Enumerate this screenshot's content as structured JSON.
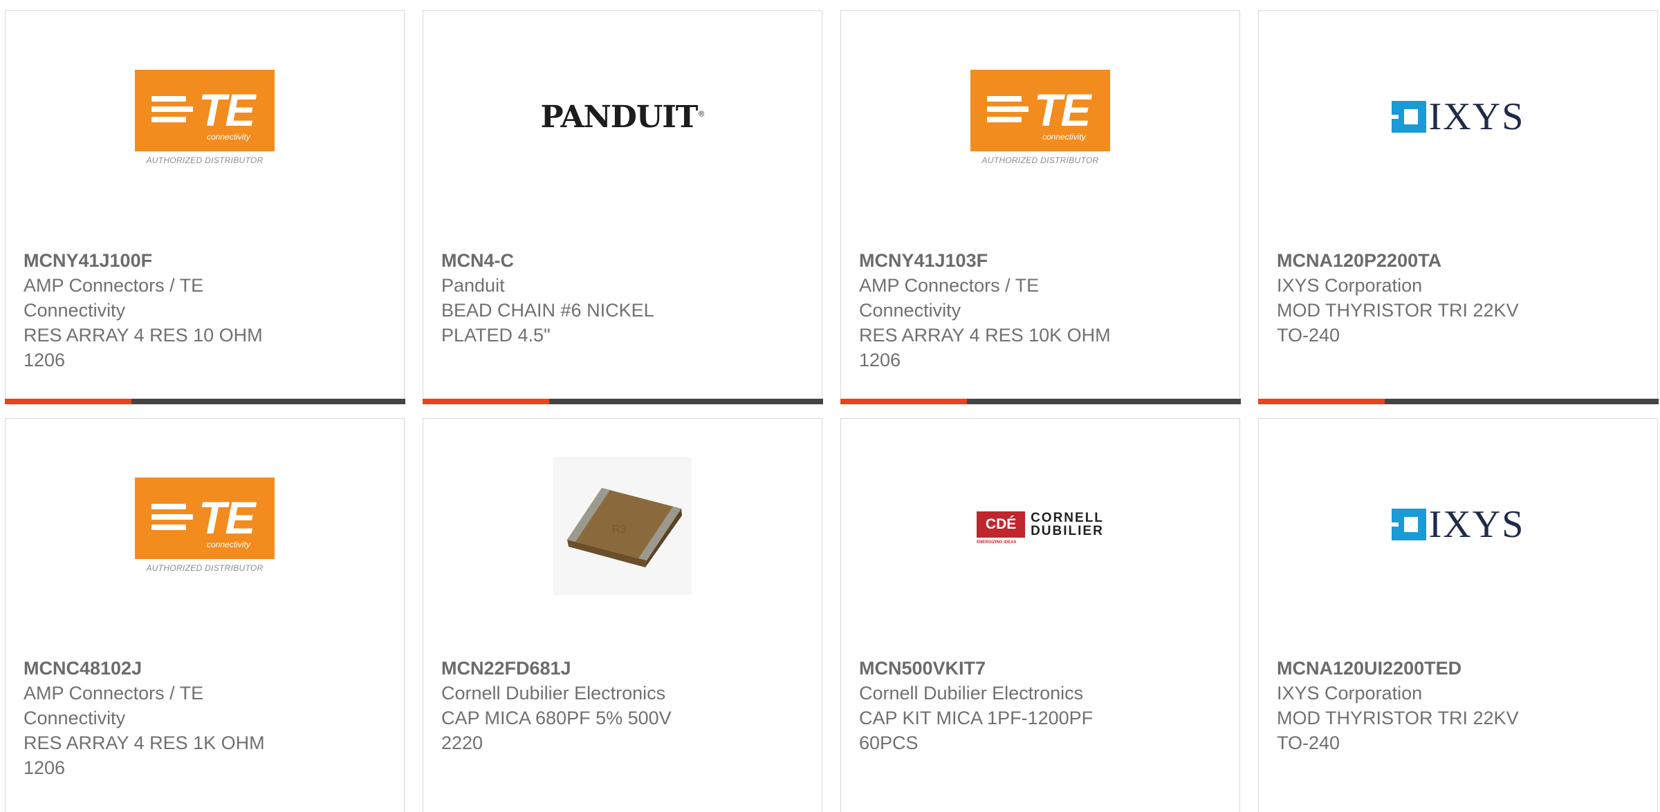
{
  "colors": {
    "accent": "#e8431a",
    "bar": "#444444",
    "te_orange": "#f28c1e",
    "cde_red": "#c0262d",
    "ixys_blue": "#1a9ad6"
  },
  "products": [
    {
      "part": "MCNY41J100F",
      "mfr": "AMP Connectors / TE Connectivity",
      "desc": "RES ARRAY 4 RES 10 OHM 1206",
      "logo": "te-logo"
    },
    {
      "part": "MCN4-C",
      "mfr": "Panduit",
      "desc": "BEAD CHAIN #6 NICKEL PLATED 4.5\"",
      "logo": "panduit-logo"
    },
    {
      "part": "MCNY41J103F",
      "mfr": "AMP Connectors / TE Connectivity",
      "desc": "RES ARRAY 4 RES 10K OHM 1206",
      "logo": "te-logo"
    },
    {
      "part": "MCNA120P2200TA",
      "mfr": "IXYS Corporation",
      "desc": "MOD THYRISTOR TRI 22KV TO-240",
      "logo": "ixys-logo"
    },
    {
      "part": "MCNC48102J",
      "mfr": "AMP Connectors / TE Connectivity",
      "desc": "RES ARRAY 4 RES 1K OHM 1206",
      "logo": "te-logo"
    },
    {
      "part": "MCN22FD681J",
      "mfr": "Cornell Dubilier Electronics",
      "desc": "CAP MICA 680PF 5% 500V 2220",
      "logo": "capacitor-image"
    },
    {
      "part": "MCN500VKIT7",
      "mfr": "Cornell Dubilier Electronics",
      "desc": "CAP KIT MICA 1PF-1200PF 60PCS",
      "logo": "cde-logo"
    },
    {
      "part": "MCNA120UI2200TED",
      "mfr": "IXYS Corporation",
      "desc": "MOD THYRISTOR TRI 22KV TO-240",
      "logo": "ixys-logo"
    }
  ],
  "logos": {
    "te": {
      "text": "TE",
      "sub": "connectivity",
      "tagline": "AUTHORIZED DISTRIBUTOR"
    },
    "panduit": {
      "text": "PANDUIT",
      "mark": "®"
    },
    "ixys": {
      "text": "IXYS"
    },
    "cde": {
      "box": "CDÉ",
      "line1": "CORNELL",
      "line2": "DUBILIER",
      "sub": "ENERGIZING IDEAS"
    }
  }
}
